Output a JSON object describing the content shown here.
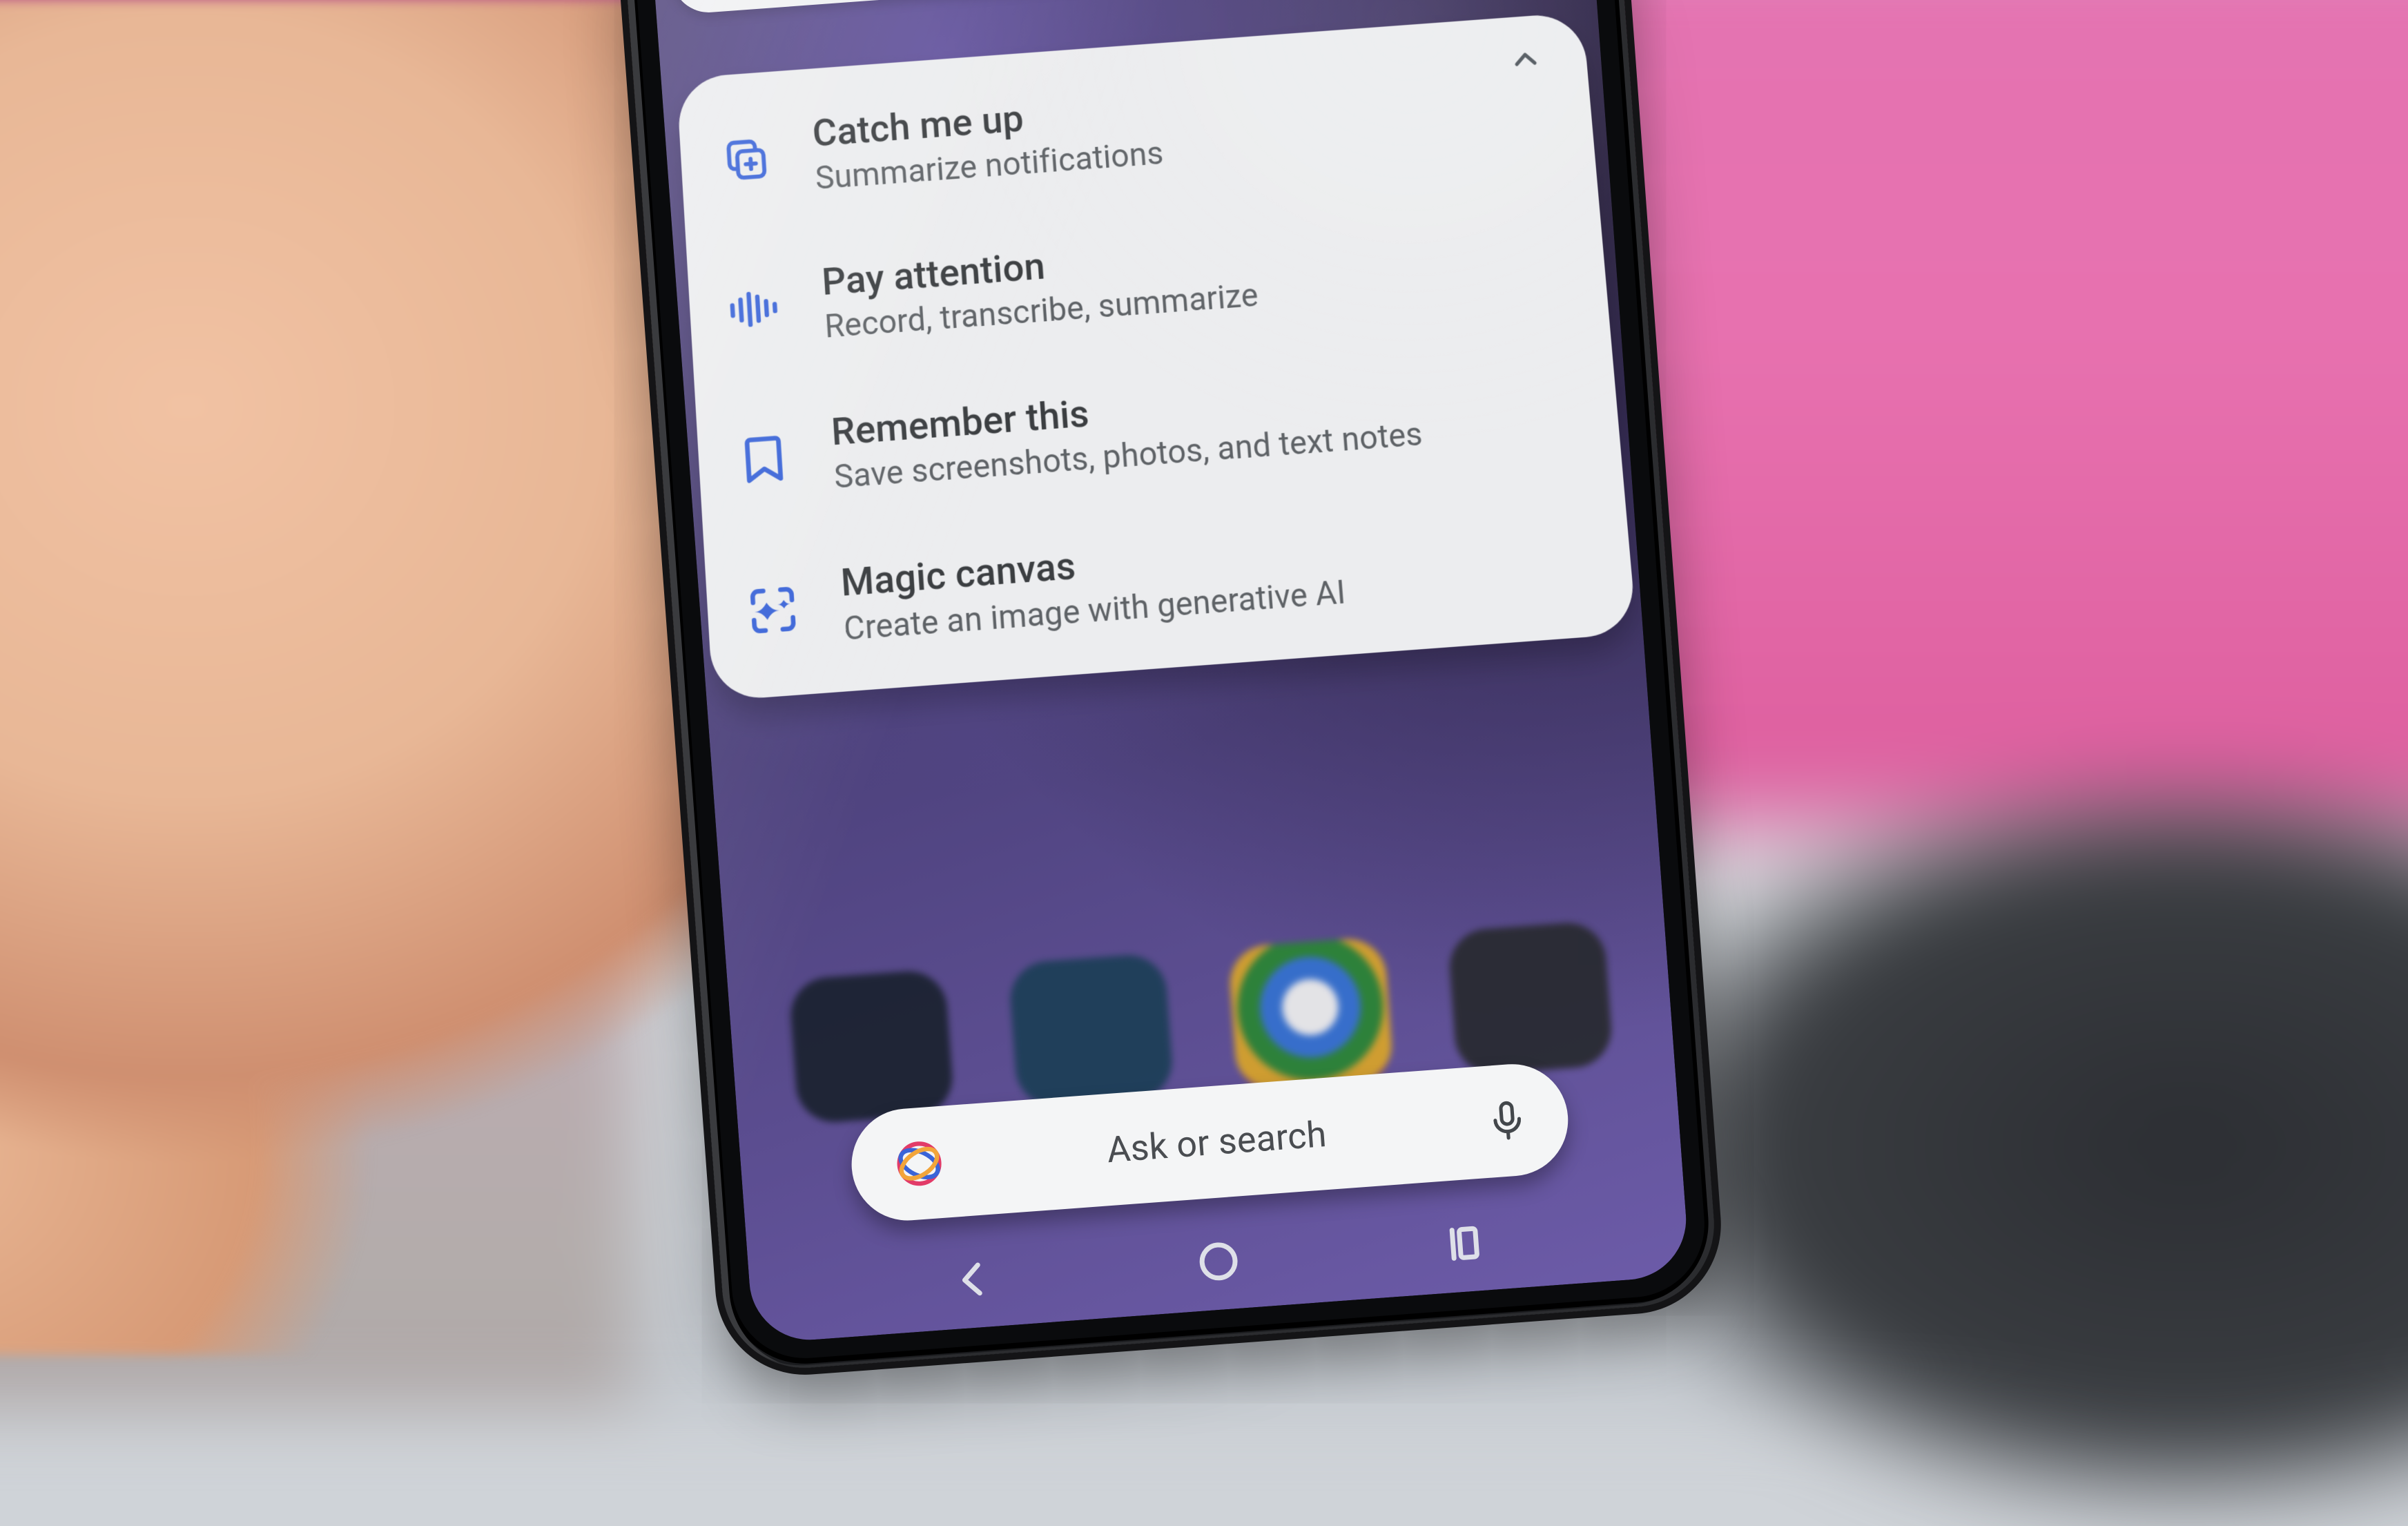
{
  "suggestions": {
    "items": [
      {
        "icon": "catch-up-icon",
        "title": "Catch me up",
        "subtitle": "Summarize notifications"
      },
      {
        "icon": "waveform-icon",
        "title": "Pay attention",
        "subtitle": "Record, transcribe, summarize"
      },
      {
        "icon": "bookmark-icon",
        "title": "Remember this",
        "subtitle": "Save screenshots, photos, and text notes"
      },
      {
        "icon": "magic-canvas-icon",
        "title": "Magic canvas",
        "subtitle": "Create an image with generative AI"
      }
    ]
  },
  "search": {
    "placeholder": "Ask or search"
  },
  "colors": {
    "icon": "#3a64d8"
  }
}
